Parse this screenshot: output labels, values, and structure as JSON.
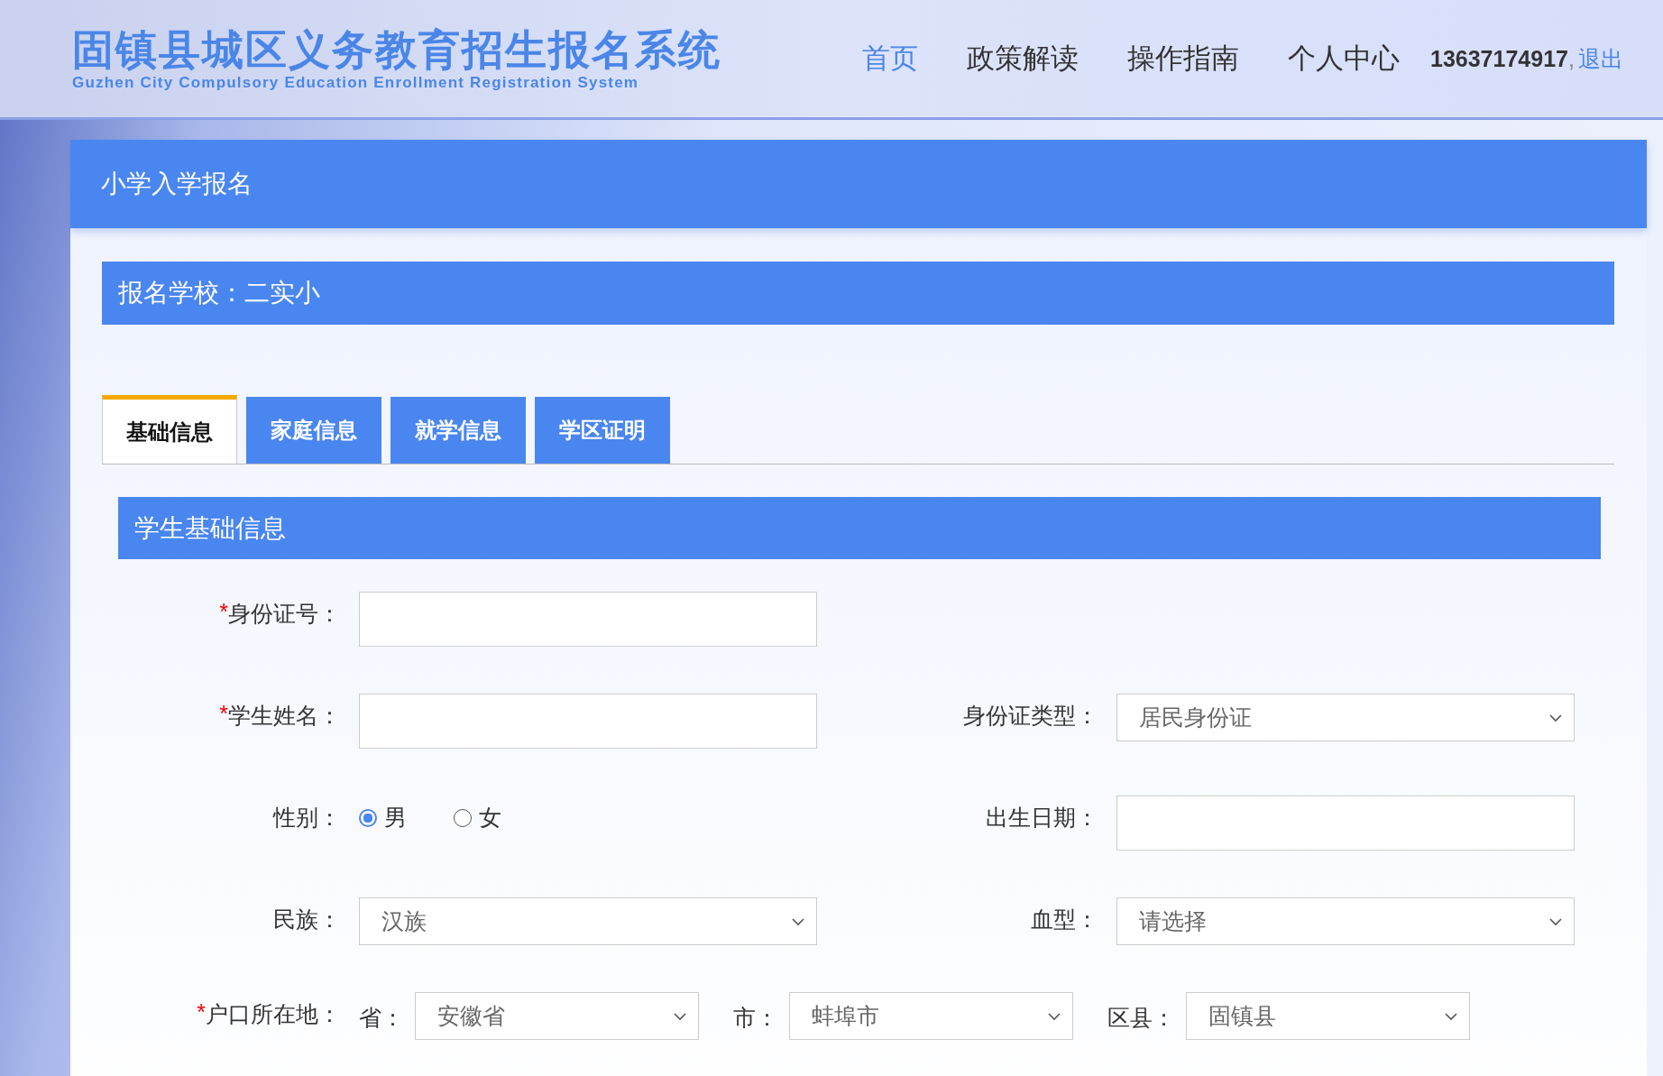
{
  "header": {
    "title": "固镇县城区义务教育招生报名系统",
    "subtitle": "Guzhen City Compulsory Education Enrollment Registration System",
    "nav": [
      {
        "label": "首页",
        "selected": true
      },
      {
        "label": "政策解读",
        "selected": false
      },
      {
        "label": "操作指南",
        "selected": false
      },
      {
        "label": "个人中心",
        "selected": false
      }
    ],
    "user": {
      "phone": "13637174917",
      "separator": ",",
      "logout": "退出"
    }
  },
  "panel": {
    "title": "小学入学报名",
    "school": "报名学校：二实小",
    "tabs": [
      {
        "label": "基础信息",
        "selected": true
      },
      {
        "label": "家庭信息",
        "selected": false
      },
      {
        "label": "就学信息",
        "selected": false
      },
      {
        "label": "学区证明",
        "selected": false
      }
    ],
    "section": "学生基础信息",
    "rows": [
      {
        "left": {
          "kind": "text",
          "required_mark": "*",
          "label": "身份证号："
        }
      },
      {
        "left": {
          "kind": "text",
          "required_mark": "*",
          "label": "学生姓名："
        },
        "right": {
          "kind": "select",
          "label": "身份证类型：",
          "value": "居民身份证"
        }
      },
      {
        "left": {
          "kind": "radio",
          "label": "性别：",
          "options": [
            {
              "label": "男",
              "selected": true
            },
            {
              "label": "女",
              "selected": false
            }
          ]
        },
        "right": {
          "kind": "text",
          "label": "出生日期："
        }
      },
      {
        "left": {
          "kind": "select",
          "label": "民族：",
          "value": "汉族"
        },
        "right": {
          "kind": "select",
          "label": "血型：",
          "value": "请选择"
        }
      },
      {
        "full": {
          "kind": "location",
          "required_mark": "*",
          "label": "户口所在地：",
          "parts": [
            {
              "label": "省：",
              "value": "安徽省"
            },
            {
              "label": "市：",
              "value": "蚌埠市"
            },
            {
              "label": "区县：",
              "value": "固镇县"
            }
          ]
        }
      }
    ]
  }
}
